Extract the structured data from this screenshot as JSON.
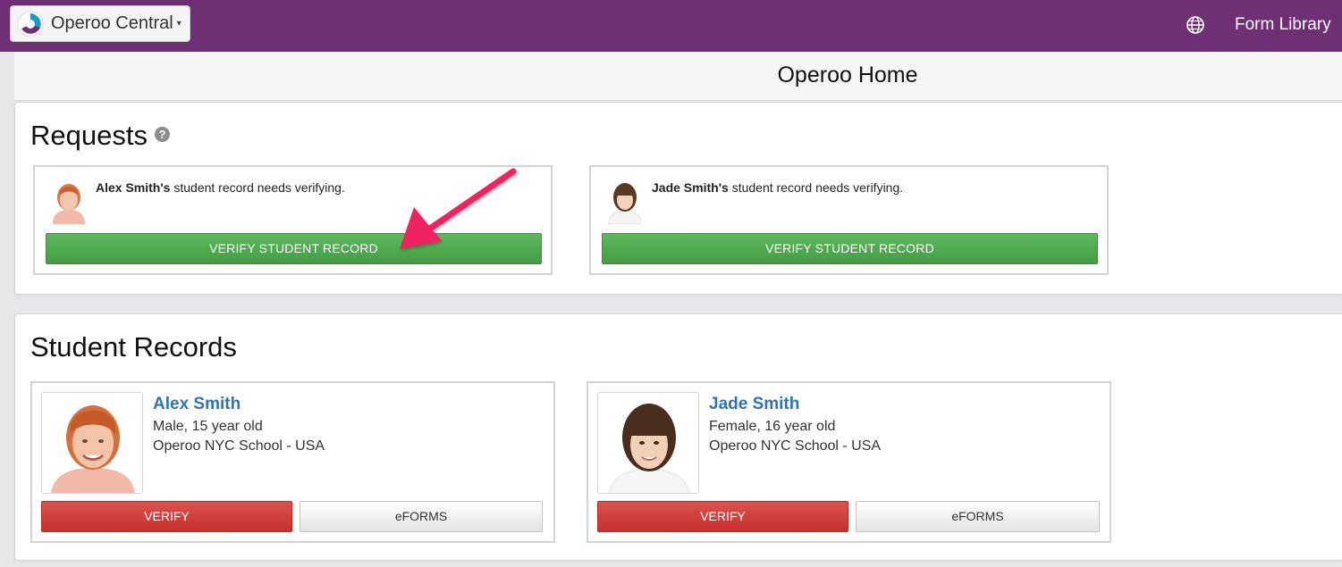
{
  "topbar": {
    "brand_label": "Operoo Central",
    "globe_icon": "globe-icon",
    "form_library": "Form Library",
    "bg_color": "#6e2f74"
  },
  "subheader": {
    "title": "Operoo Home"
  },
  "requests": {
    "title": "Requests",
    "help_icon": "question-circle-icon",
    "help_glyph": "?",
    "items": [
      {
        "name": "Alex Smith's",
        "message": " student record needs verifying.",
        "button": "VERIFY STUDENT RECORD"
      },
      {
        "name": "Jade Smith's",
        "message": " student record needs verifying.",
        "button": "VERIFY STUDENT RECORD"
      }
    ]
  },
  "records": {
    "title": "Student Records",
    "items": [
      {
        "name": "Alex Smith",
        "details": "Male, 15 year old",
        "school": "Operoo NYC School - USA",
        "verify": "VERIFY",
        "eforms": "eFORMS"
      },
      {
        "name": "Jade Smith",
        "details": "Female, 16 year old",
        "school": "Operoo NYC School - USA",
        "verify": "VERIFY",
        "eforms": "eFORMS"
      }
    ]
  },
  "colors": {
    "verify_green": "#5cb85c",
    "verify_red": "#d9534f",
    "name_link": "#3174ad",
    "arrow": "#f0245e"
  }
}
